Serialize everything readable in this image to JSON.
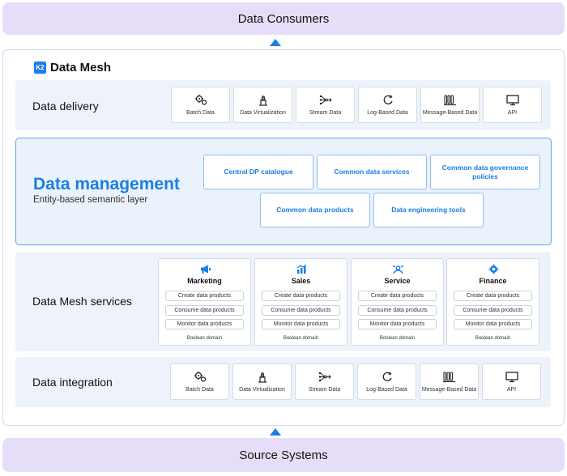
{
  "top_band": "Data Consumers",
  "bottom_band": "Source Systems",
  "mesh": {
    "logo": "K2",
    "title": "Data Mesh"
  },
  "delivery": {
    "label": "Data delivery",
    "tiles": [
      {
        "label": "Batch Data",
        "icon": "gears-icon"
      },
      {
        "label": "Data Virtualization",
        "icon": "virtualization-icon"
      },
      {
        "label": "Stream Data",
        "icon": "stream-icon"
      },
      {
        "label": "Log-Based Data",
        "icon": "log-icon"
      },
      {
        "label": "Message-Based Data",
        "icon": "message-icon"
      },
      {
        "label": "API",
        "icon": "monitor-icon"
      }
    ]
  },
  "management": {
    "title": "Data management",
    "subtitle": "Entity-based semantic layer",
    "boxes": [
      "Central DP catalogue",
      "Common data services",
      "Common data governance policies",
      "Common data products",
      "Data engineering tools"
    ]
  },
  "services": {
    "label": "Data Mesh services",
    "domains": [
      {
        "name": "Marketing",
        "icon": "megaphone-icon",
        "actions": [
          "Create data products",
          "Consume data products",
          "Monitor data products"
        ],
        "footer": "Boolean domain"
      },
      {
        "name": "Sales",
        "icon": "sales-chart-icon",
        "actions": [
          "Create data products",
          "Consume data products",
          "Monitor data products"
        ],
        "footer": "Boolean domain"
      },
      {
        "name": "Service",
        "icon": "service-icon",
        "actions": [
          "Create data products",
          "Consume data products",
          "Monitor data products"
        ],
        "footer": "Boolean domain"
      },
      {
        "name": "Finance",
        "icon": "finance-gear-icon",
        "actions": [
          "Create data products",
          "Consume data products",
          "Monitor data products"
        ],
        "footer": "Boolean domain"
      }
    ]
  },
  "integration": {
    "label": "Data integration",
    "tiles": [
      {
        "label": "Batch Data",
        "icon": "gears-icon"
      },
      {
        "label": "Data Virtualization",
        "icon": "virtualization-icon"
      },
      {
        "label": "Stream Data",
        "icon": "stream-icon"
      },
      {
        "label": "Log-Based Data",
        "icon": "log-icon"
      },
      {
        "label": "Message-Based Data",
        "icon": "message-icon"
      },
      {
        "label": "API",
        "icon": "monitor-icon"
      }
    ]
  },
  "colors": {
    "accent": "#1a7ee6",
    "band": "#e6def8",
    "row": "#eef3fb"
  }
}
